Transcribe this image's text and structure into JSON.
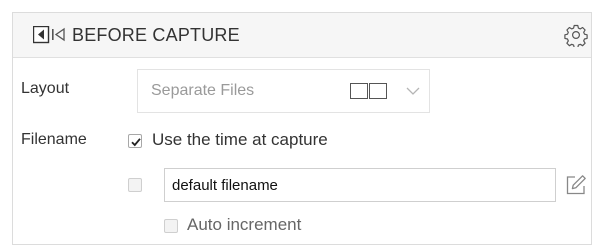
{
  "panel": {
    "title": "BEFORE CAPTURE",
    "title_icon": "before-capture-icon",
    "settings_icon": "gear-icon"
  },
  "layout": {
    "label": "Layout",
    "selected": "Separate Files",
    "mode_icon": "split-panes-icon",
    "dropdown_icon": "chevron-down-icon"
  },
  "filename": {
    "label": "Filename",
    "use_time_label": "Use the time at capture",
    "use_time_checked": true,
    "custom_checked": false,
    "input_value": "default filename",
    "edit_icon": "edit-pencil-icon",
    "auto_increment_label": "Auto increment",
    "auto_increment_checked": false,
    "auto_increment_disabled": true
  },
  "colors": {
    "header_bg": "#f6f6f6",
    "border": "#dcdcdc",
    "text": "#333333",
    "muted_text": "#9a9a9a"
  }
}
